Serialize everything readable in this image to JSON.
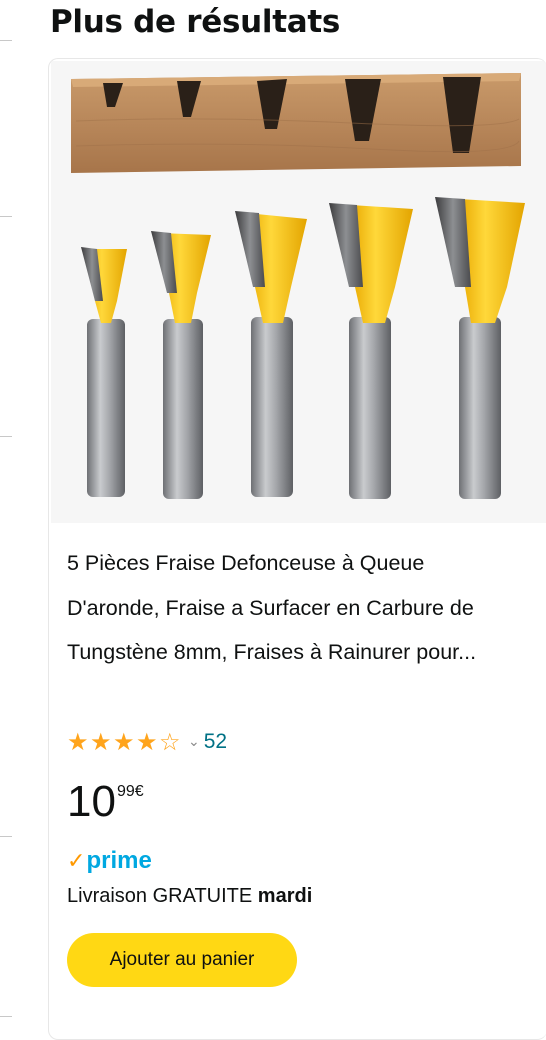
{
  "section": {
    "title": "Plus de résultats"
  },
  "product": {
    "image_alt": "5 fraises queue d'aronde",
    "title": "5 Pièces Fraise Defonceuse à Queue D'aronde, Fraise a Surfacer en Carbure de Tungstène 8mm, Fraises à Rainurer pour...",
    "rating": {
      "stars": 4,
      "max_stars": 5,
      "count": "52"
    },
    "price": {
      "whole": "10",
      "fraction": "99",
      "currency": "€"
    },
    "prime_label": "prime",
    "delivery": {
      "prefix": "Livraison GRATUITE",
      "day": "mardi"
    },
    "add_to_cart_label": "Ajouter au panier"
  },
  "colors": {
    "accent_button": "#ffd814",
    "star": "#ffa41c",
    "link": "#007185",
    "prime_blue": "#00a8e1",
    "prime_check": "#ff9900",
    "bit_yellow": "#f5c21a",
    "shank_gray": "#9a9ca0"
  }
}
